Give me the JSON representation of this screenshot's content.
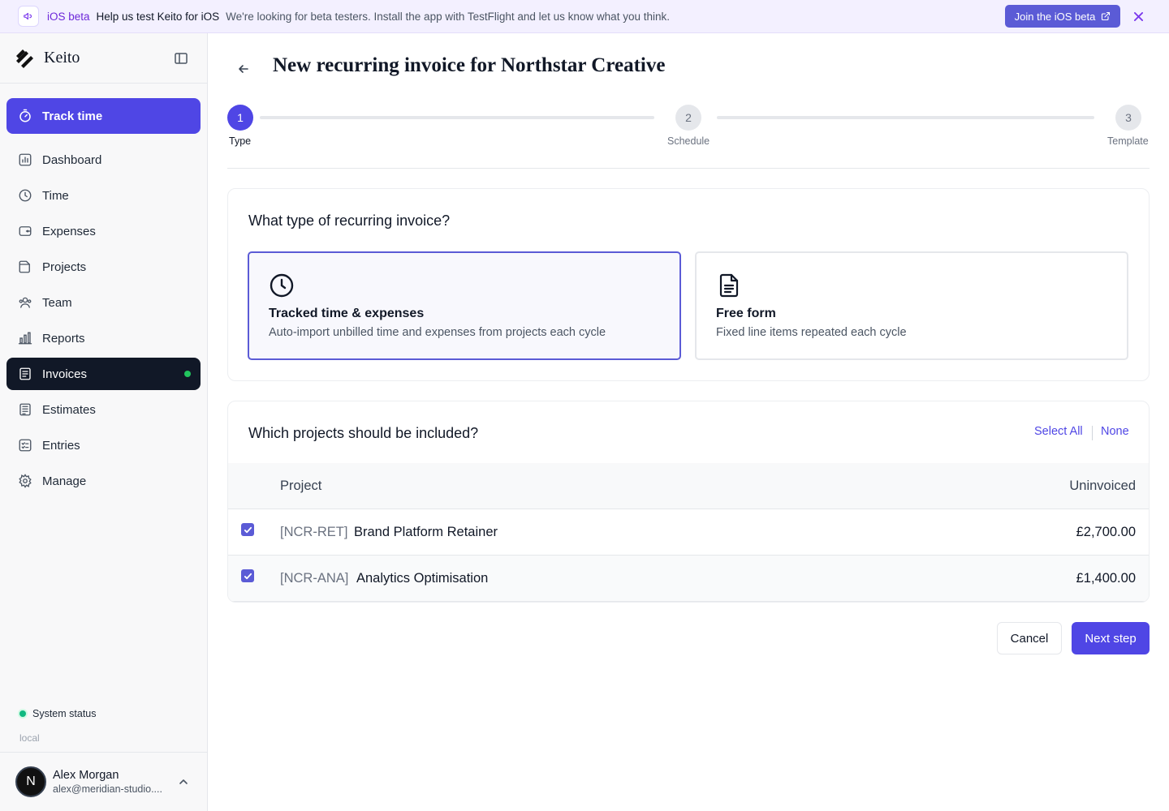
{
  "banner": {
    "tag": "iOS beta",
    "title": "Help us test Keito for iOS",
    "text": "We're looking for beta testers. Install the app with TestFlight and let us know what you think.",
    "button_label": "Join the iOS beta"
  },
  "sidebar": {
    "app_name": "Keito",
    "track_time_label": "Track time",
    "items": [
      {
        "label": "Dashboard",
        "icon": "dashboard-icon"
      },
      {
        "label": "Time",
        "icon": "clock-icon"
      },
      {
        "label": "Expenses",
        "icon": "wallet-icon"
      },
      {
        "label": "Projects",
        "icon": "folder-icon"
      },
      {
        "label": "Team",
        "icon": "team-icon"
      },
      {
        "label": "Reports",
        "icon": "bar-chart-icon"
      },
      {
        "label": "Invoices",
        "icon": "invoice-icon",
        "active": true
      },
      {
        "label": "Estimates",
        "icon": "estimate-icon"
      },
      {
        "label": "Entries",
        "icon": "entries-icon"
      },
      {
        "label": "Manage",
        "icon": "gear-icon"
      }
    ],
    "system_status": "System status",
    "environment": "local",
    "user": {
      "initial": "N",
      "name": "Alex Morgan",
      "email": "alex@meridian-studio...."
    }
  },
  "page": {
    "title": "New recurring invoice for Northstar Creative",
    "steps": [
      {
        "number": "1",
        "label": "Type",
        "active": true
      },
      {
        "number": "2",
        "label": "Schedule",
        "active": false
      },
      {
        "number": "3",
        "label": "Template",
        "active": false
      }
    ]
  },
  "type_card": {
    "question": "What type of recurring invoice?",
    "options": [
      {
        "title": "Tracked time & expenses",
        "description": "Auto-import unbilled time and expenses from projects each cycle",
        "selected": true
      },
      {
        "title": "Free form",
        "description": "Fixed line items repeated each cycle",
        "selected": false
      }
    ]
  },
  "projects_card": {
    "question": "Which projects should be included?",
    "select_all": "Select All",
    "select_none": "None",
    "columns": [
      "Project",
      "Uninvoiced"
    ],
    "rows": [
      {
        "code": "[NCR-RET]",
        "name": "Brand Platform Retainer",
        "amount": "£2,700.00",
        "checked": true
      },
      {
        "code": "[NCR-ANA]",
        "name": "Analytics Optimisation",
        "amount": "£1,400.00",
        "checked": true
      }
    ]
  },
  "actions": {
    "cancel": "Cancel",
    "next": "Next step"
  },
  "colors": {
    "accent": "#4f46e5",
    "nav_active": "#111827",
    "status_green": "#22c55e"
  }
}
